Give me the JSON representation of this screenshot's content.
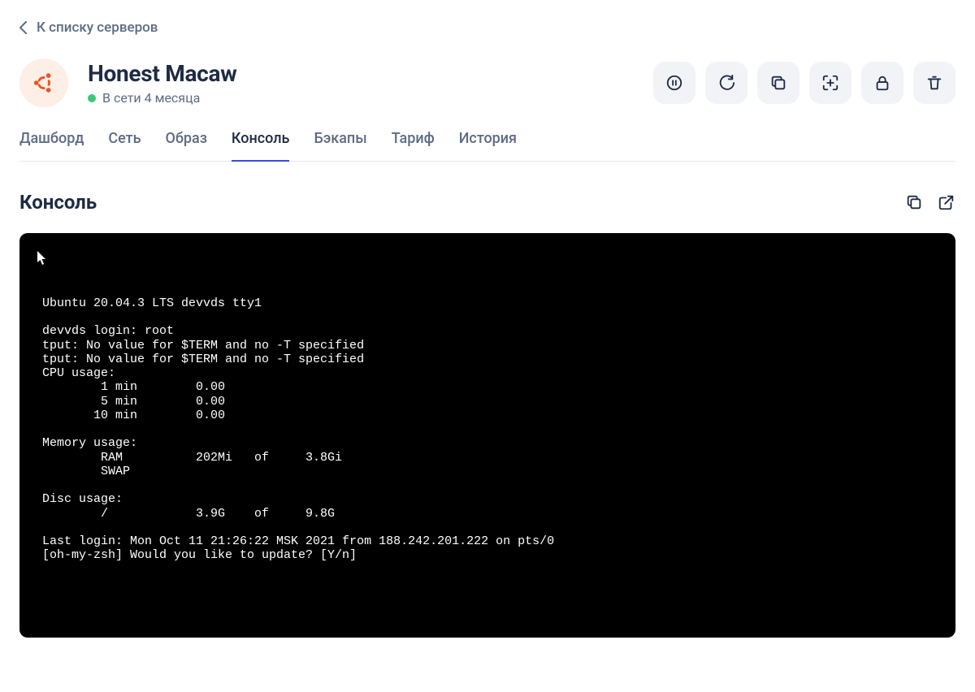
{
  "back_link": "К списку серверов",
  "server": {
    "name": "Honest Macaw",
    "status_text": "В сети 4 месяца",
    "status_color": "#3ec57a",
    "os_icon": "ubuntu-icon"
  },
  "action_buttons": [
    {
      "name": "pause-button",
      "icon": "pause-icon"
    },
    {
      "name": "restart-button",
      "icon": "refresh-icon"
    },
    {
      "name": "clone-button",
      "icon": "copy-icon"
    },
    {
      "name": "rescue-button",
      "icon": "scan-icon"
    },
    {
      "name": "lock-button",
      "icon": "lock-icon"
    },
    {
      "name": "delete-button",
      "icon": "trash-icon"
    }
  ],
  "tabs": [
    {
      "label": "Дашборд",
      "active": false
    },
    {
      "label": "Сеть",
      "active": false
    },
    {
      "label": "Образ",
      "active": false
    },
    {
      "label": "Консоль",
      "active": true
    },
    {
      "label": "Бэкапы",
      "active": false
    },
    {
      "label": "Тариф",
      "active": false
    },
    {
      "label": "История",
      "active": false
    }
  ],
  "section": {
    "title": "Консоль",
    "actions": [
      {
        "name": "copy-output-button",
        "icon": "copy-icon"
      },
      {
        "name": "open-external-button",
        "icon": "external-link-icon"
      }
    ]
  },
  "terminal_output": "Ubuntu 20.04.3 LTS devvds tty1\n\ndevvds login: root\ntput: No value for $TERM and no -T specified\ntput: No value for $TERM and no -T specified\nCPU usage:\n        1 min        0.00\n        5 min        0.00\n       10 min        0.00\n\nMemory usage:\n        RAM          202Mi   of     3.8Gi\n        SWAP\n\nDisc usage:\n        /            3.9G    of     9.8G\n\nLast login: Mon Oct 11 21:26:22 MSK 2021 from 188.242.201.222 on pts/0\n[oh-my-zsh] Would you like to update? [Y/n]"
}
